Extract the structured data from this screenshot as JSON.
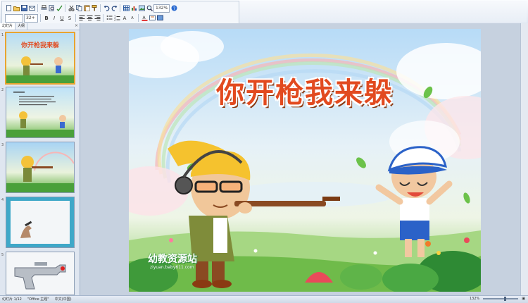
{
  "toolbar": {
    "font_size": "32+",
    "row1_icons": [
      "new-icon",
      "open-icon",
      "save-icon",
      "email-icon",
      "print-icon",
      "preview-icon",
      "spell-icon",
      "cut-icon",
      "copy-icon",
      "paste-icon",
      "format-painter-icon",
      "undo-icon",
      "redo-icon",
      "table-icon",
      "chart-icon",
      "insert-picture-icon",
      "zoom-icon",
      "help-icon"
    ],
    "row2_icons": [
      "bold-icon",
      "italic-icon",
      "underline-icon",
      "shadow-icon",
      "align-left-icon",
      "align-center-icon",
      "align-right-icon",
      "bullets-icon",
      "numbering-icon",
      "increase-font-icon",
      "decrease-font-icon",
      "font-color-icon",
      "new-slide-icon",
      "design-icon"
    ]
  },
  "left_panel": {
    "tabs": [
      "幻灯片",
      "大纲"
    ],
    "slides": [
      {
        "number": "1",
        "selected": true
      },
      {
        "number": "2",
        "selected": false
      },
      {
        "number": "3",
        "selected": false
      },
      {
        "number": "4",
        "selected": false
      },
      {
        "number": "5",
        "selected": false
      }
    ]
  },
  "slide": {
    "title": "你开枪我来躲",
    "watermark_text": "幼教资源站",
    "watermark_url": "ziyuan.baby611.com"
  },
  "status_bar": {
    "slide_indicator": "幻灯片 1/12",
    "theme": "\"Office 主题\"",
    "language": "中文(中国)",
    "zoom": "132%"
  },
  "colors": {
    "title": "#e24a1f",
    "selection": "#e8a430",
    "ribbon": "#dfe7f2"
  }
}
